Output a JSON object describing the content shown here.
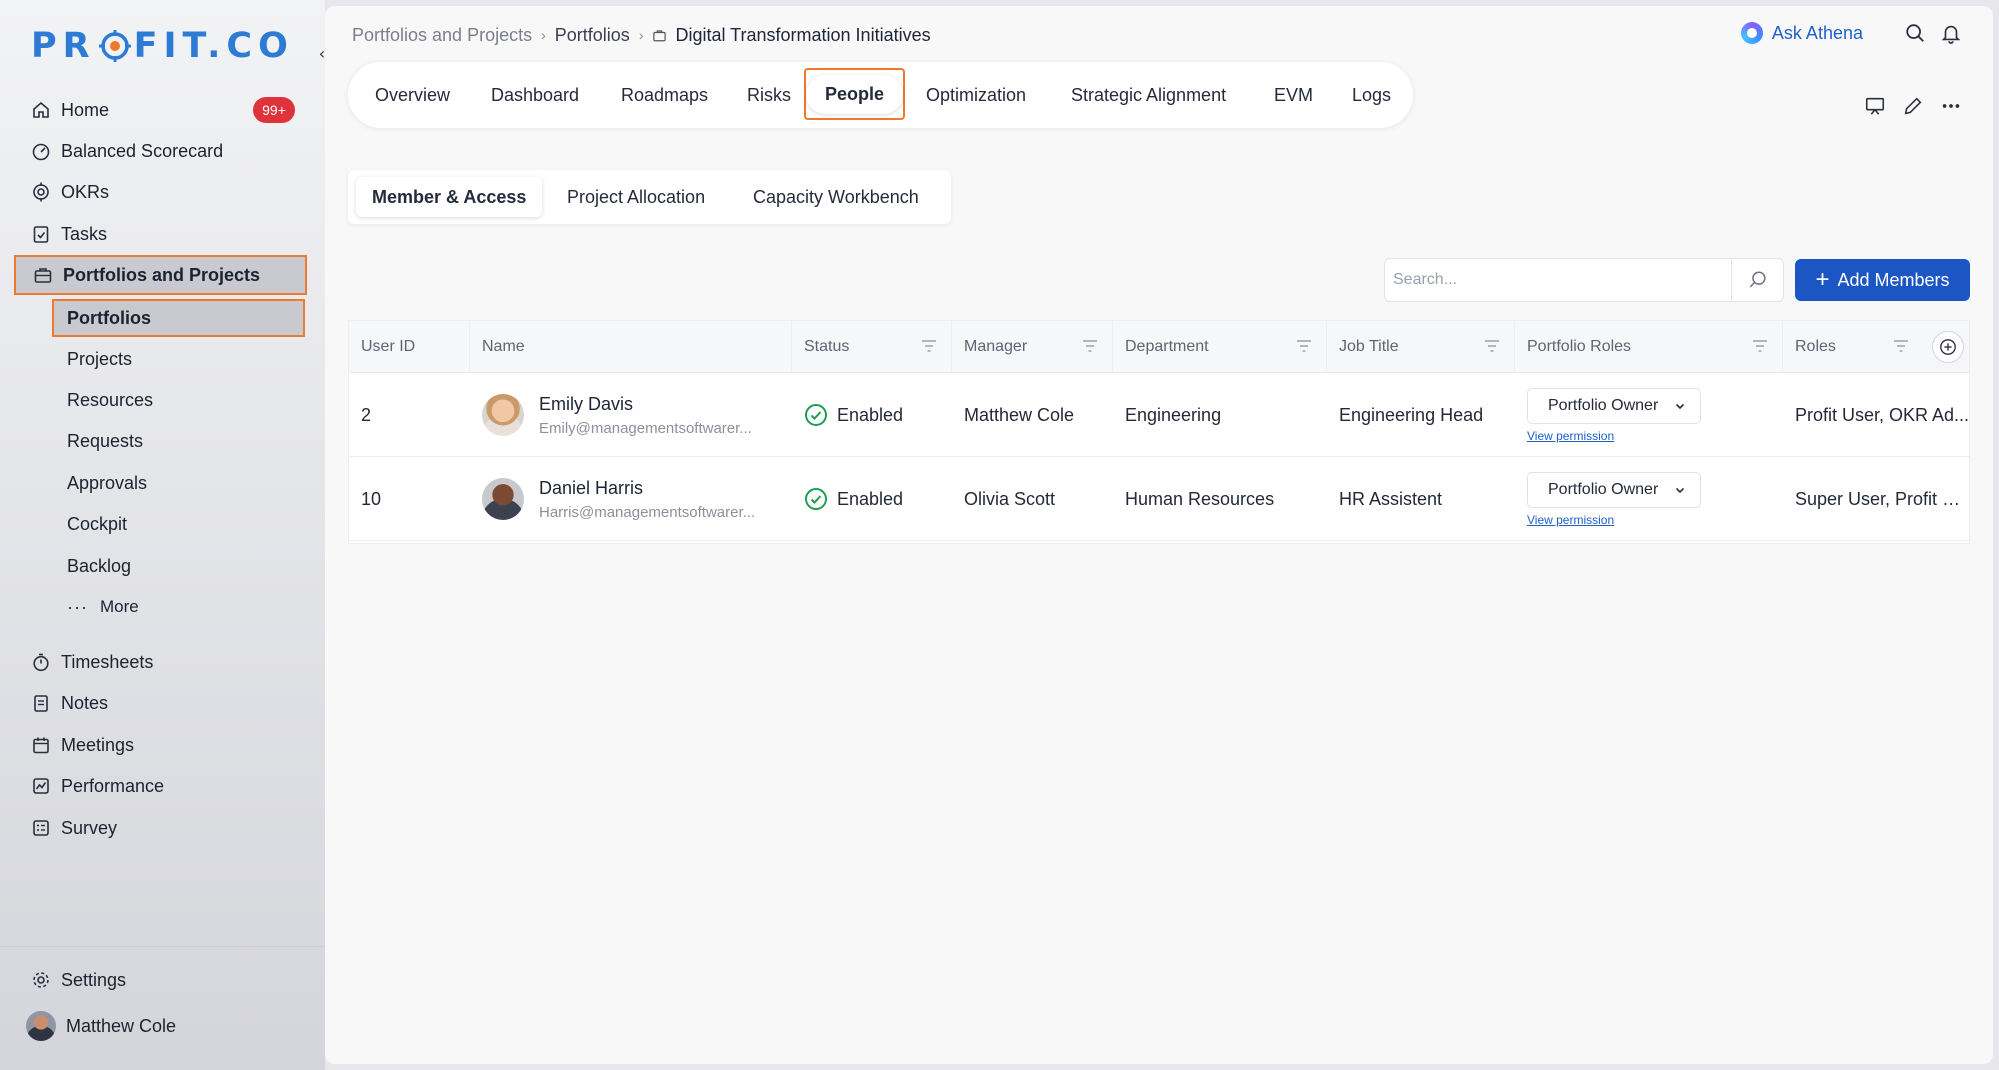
{
  "app": {
    "logo_text_left": "PR",
    "logo_text_right": "FIT.CO",
    "brand_color": "#2e7bd6",
    "accent_highlight": "#ef7a2e"
  },
  "sidebar": {
    "items": [
      {
        "label": "Home",
        "icon": "home-icon",
        "badge": "99+"
      },
      {
        "label": "Balanced Scorecard",
        "icon": "gauge-icon"
      },
      {
        "label": "OKRs",
        "icon": "target-icon"
      },
      {
        "label": "Tasks",
        "icon": "checklist-icon"
      },
      {
        "label": "Portfolios and Projects",
        "icon": "briefcase-icon",
        "active": true
      }
    ],
    "sub_items": [
      {
        "label": "Portfolios",
        "active": true
      },
      {
        "label": "Projects"
      },
      {
        "label": "Resources"
      },
      {
        "label": "Requests"
      },
      {
        "label": "Approvals"
      },
      {
        "label": "Cockpit"
      },
      {
        "label": "Backlog"
      },
      {
        "label": "More"
      }
    ],
    "items_lower": [
      {
        "label": "Timesheets",
        "icon": "stopwatch-icon"
      },
      {
        "label": "Notes",
        "icon": "notes-icon"
      },
      {
        "label": "Meetings",
        "icon": "calendar-icon"
      },
      {
        "label": "Performance",
        "icon": "chart-icon"
      },
      {
        "label": "Survey",
        "icon": "survey-icon"
      }
    ],
    "settings_label": "Settings",
    "user_name": "Matthew Cole"
  },
  "header": {
    "breadcrumb": [
      "Portfolios and Projects",
      "Portfolios",
      "Digital Transformation Initiatives"
    ],
    "ask_athena": "Ask Athena"
  },
  "tabs": [
    "Overview",
    "Dashboard",
    "Roadmaps",
    "Risks",
    "People",
    "Optimization",
    "Strategic Alignment",
    "EVM",
    "Logs"
  ],
  "active_tab": "People",
  "subtabs": [
    "Member & Access",
    "Project Allocation",
    "Capacity Workbench"
  ],
  "active_subtab": "Member & Access",
  "search": {
    "placeholder": "Search...",
    "value": ""
  },
  "add_members_label": "Add Members",
  "table": {
    "columns": [
      "User ID",
      "Name",
      "Status",
      "Manager",
      "Department",
      "Job Title",
      "Portfolio Roles",
      "Roles"
    ],
    "rows": [
      {
        "user_id": "2",
        "name": "Emily Davis",
        "email": "Emily@managementsoftwarer...",
        "status": "Enabled",
        "manager": "Matthew Cole",
        "department": "Engineering",
        "job_title": "Engineering Head",
        "portfolio_role": "Portfolio Owner",
        "view_permission": "View permission",
        "roles": "Profit User, OKR Ad..."
      },
      {
        "user_id": "10",
        "name": "Daniel Harris",
        "email": "Harris@managementsoftwarer...",
        "status": "Enabled",
        "manager": "Olivia Scott",
        "department": "Human Resources",
        "job_title": "HR Assistent",
        "portfolio_role": "Portfolio Owner",
        "view_permission": "View permission",
        "roles": "Super User, Profit Us..."
      }
    ]
  }
}
